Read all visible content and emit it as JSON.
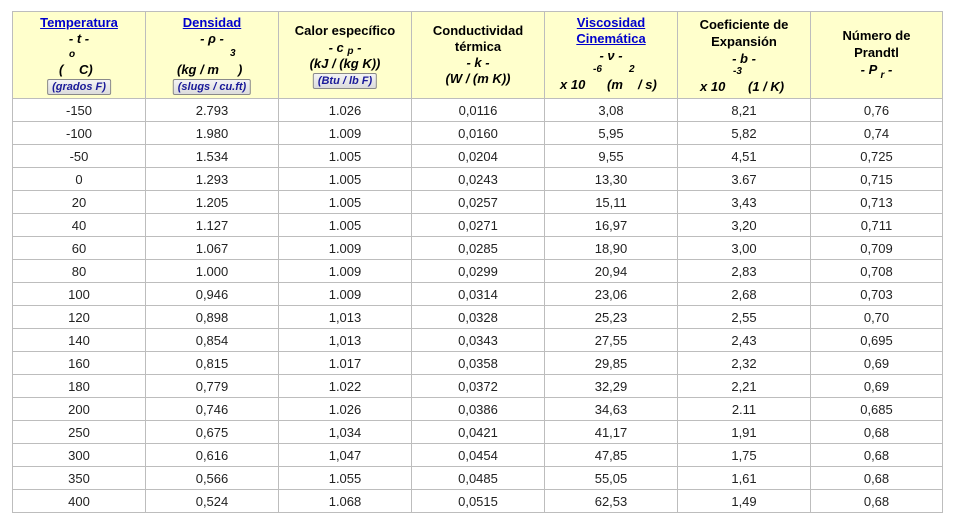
{
  "headers": {
    "temperatura": {
      "title": "Temperatura",
      "symbol": "- t -",
      "deg": "o",
      "unit_open": "(",
      "unit_letter": "C)",
      "button": "(grados F)"
    },
    "densidad": {
      "title": "Densidad",
      "symbol": "- ρ -",
      "exp": "3",
      "unit_main": "(kg / m",
      "unit_close": ")",
      "button": "(slugs / cu.ft)"
    },
    "calor": {
      "title": "Calor específico",
      "symbol_pre": "- c",
      "symbol_sub": "p",
      "symbol_post": "-",
      "unit": "(kJ / (kg K))",
      "button": "(Btu / lb F)"
    },
    "conductividad": {
      "line1": "Conductividad",
      "line2": "térmica",
      "symbol": "- k -",
      "unit": "(W / (m K))"
    },
    "viscosidad": {
      "line1": "Viscosidad",
      "line2": "Cinemática",
      "symbol": "- ν -",
      "exp_neg": "-6",
      "exp2": "2",
      "unit_a": "x 10",
      "unit_b": "(m",
      "unit_c": "/ s)"
    },
    "expansion": {
      "line1": "Coeficiente de",
      "line2": "Expansión",
      "symbol": "- b -",
      "exp_neg": "-3",
      "unit_a": "x 10",
      "unit_b": "(1 / K)"
    },
    "prandtl": {
      "line1": "Número de",
      "line2": "Prandtl",
      "symbol_pre": "- P",
      "symbol_sub": "r",
      "symbol_post": "-"
    }
  },
  "rows": [
    [
      "-150",
      "2.793",
      "1.026",
      "0,0116",
      "3,08",
      "8,21",
      "0,76"
    ],
    [
      "-100",
      "1.980",
      "1.009",
      "0,0160",
      "5,95",
      "5,82",
      "0,74"
    ],
    [
      "-50",
      "1.534",
      "1.005",
      "0,0204",
      "9,55",
      "4,51",
      "0,725"
    ],
    [
      "0",
      "1.293",
      "1.005",
      "0,0243",
      "13,30",
      "3.67",
      "0,715"
    ],
    [
      "20",
      "1.205",
      "1.005",
      "0,0257",
      "15,11",
      "3,43",
      "0,713"
    ],
    [
      "40",
      "1.127",
      "1.005",
      "0,0271",
      "16,97",
      "3,20",
      "0,711"
    ],
    [
      "60",
      "1.067",
      "1.009",
      "0,0285",
      "18,90",
      "3,00",
      "0,709"
    ],
    [
      "80",
      "1.000",
      "1.009",
      "0,0299",
      "20,94",
      "2,83",
      "0,708"
    ],
    [
      "100",
      "0,946",
      "1.009",
      "0,0314",
      "23,06",
      "2,68",
      "0,703"
    ],
    [
      "120",
      "0,898",
      "1,013",
      "0,0328",
      "25,23",
      "2,55",
      "0,70"
    ],
    [
      "140",
      "0,854",
      "1,013",
      "0,0343",
      "27,55",
      "2,43",
      "0,695"
    ],
    [
      "160",
      "0,815",
      "1.017",
      "0,0358",
      "29,85",
      "2,32",
      "0,69"
    ],
    [
      "180",
      "0,779",
      "1.022",
      "0,0372",
      "32,29",
      "2,21",
      "0,69"
    ],
    [
      "200",
      "0,746",
      "1.026",
      "0,0386",
      "34,63",
      "2.11",
      "0,685"
    ],
    [
      "250",
      "0,675",
      "1,034",
      "0,0421",
      "41,17",
      "1,91",
      "0,68"
    ],
    [
      "300",
      "0,616",
      "1,047",
      "0,0454",
      "47,85",
      "1,75",
      "0,68"
    ],
    [
      "350",
      "0,566",
      "1.055",
      "0,0485",
      "55,05",
      "1,61",
      "0,68"
    ],
    [
      "400",
      "0,524",
      "1.068",
      "0,0515",
      "62,53",
      "1,49",
      "0,68"
    ]
  ]
}
